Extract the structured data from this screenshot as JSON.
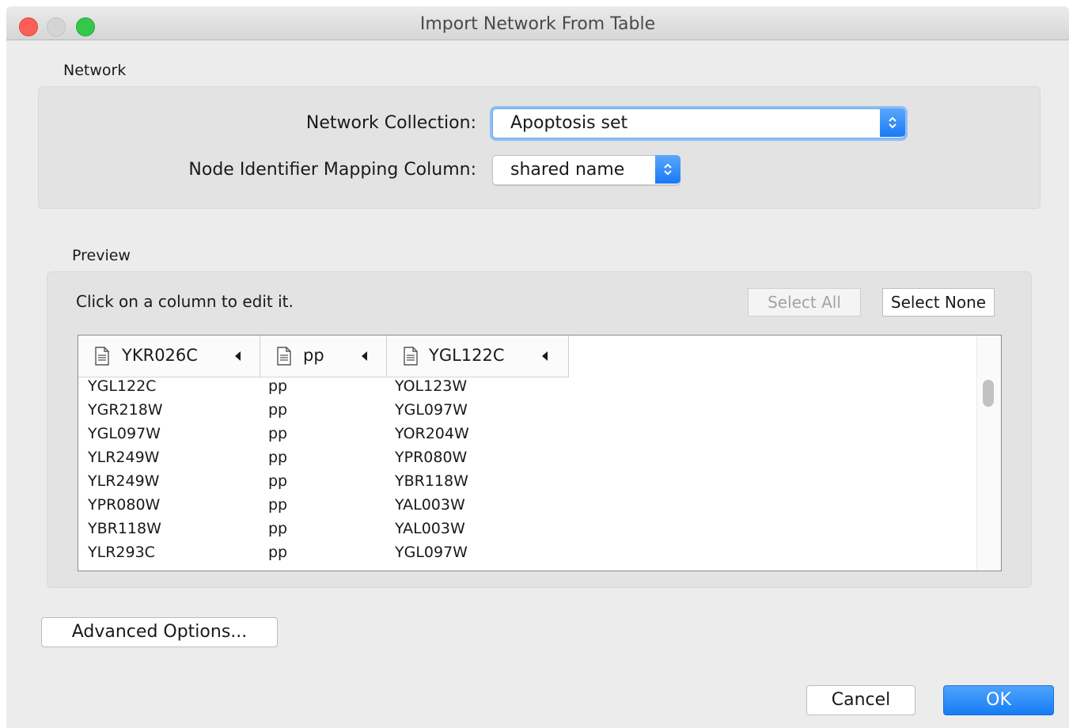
{
  "window": {
    "title": "Import Network From Table"
  },
  "network": {
    "section_label": "Network",
    "collection_label": "Network Collection:",
    "collection_value": "Apoptosis set",
    "mapping_label": "Node Identifier Mapping Column:",
    "mapping_value": "shared name"
  },
  "preview": {
    "section_label": "Preview",
    "hint": "Click on a column to edit it.",
    "select_all": "Select All",
    "select_none": "Select None",
    "columns": [
      "YKR026C",
      "pp",
      "YGL122C"
    ],
    "rows": [
      [
        "YGL122C",
        "pp",
        "YOL123W"
      ],
      [
        "YGR218W",
        "pp",
        "YGL097W"
      ],
      [
        "YGL097W",
        "pp",
        "YOR204W"
      ],
      [
        "YLR249W",
        "pp",
        "YPR080W"
      ],
      [
        "YLR249W",
        "pp",
        "YBR118W"
      ],
      [
        "YPR080W",
        "pp",
        "YAL003W"
      ],
      [
        "YBR118W",
        "pp",
        "YAL003W"
      ],
      [
        "YLR293C",
        "pp",
        "YGL097W"
      ]
    ]
  },
  "buttons": {
    "advanced": "Advanced Options...",
    "cancel": "Cancel",
    "ok": "OK"
  },
  "colors": {
    "accent": "#1a79f5",
    "close": "#fc5f57",
    "maximize": "#34c84a"
  }
}
